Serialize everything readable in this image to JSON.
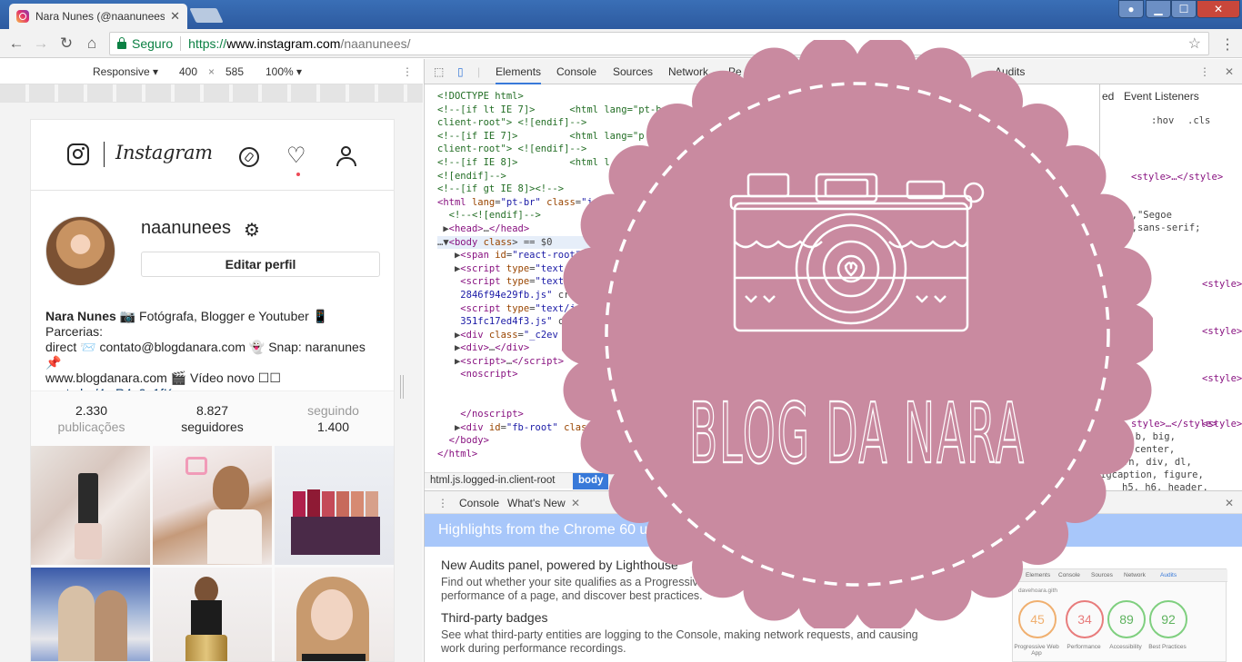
{
  "browser": {
    "tab_title": "Nara Nunes (@naanunees",
    "tab_close": "✕",
    "secure_label": "Seguro",
    "url_scheme": "https://",
    "url_host": "www.instagram.com",
    "url_path": "/naanunees/"
  },
  "device_toolbar": {
    "mode": "Responsive ▾",
    "width": "400",
    "times": "×",
    "height": "585",
    "zoom": "100% ▾"
  },
  "instagram": {
    "wordmark": "Instagram",
    "username": "naanunees",
    "edit_button": "Editar perfil",
    "bio_name": "Nara Nunes",
    "bio_line1": " 📷 Fotógrafa, Blogger e Youtuber 📱Parcerias:",
    "bio_line2": "direct 📨 contato@blogdanara.com 👻 Snap: naranunes 📌",
    "bio_line3": "www.blogdanara.com 🎬 Vídeo novo ☐☐",
    "bio_link": "youtu.be/4mR4u9o1fKw",
    "stats": [
      {
        "num": "2.330",
        "label": "publicações"
      },
      {
        "num": "8.827",
        "label": "seguidores"
      },
      {
        "num": "1.400",
        "label": "seguindo"
      }
    ]
  },
  "devtools": {
    "tabs": [
      "Elements",
      "Console",
      "Sources",
      "Network",
      "Pe",
      "Audits"
    ],
    "breadcrumb_path": "html.js.logged-in.client-root",
    "breadcrumb_active": "body",
    "styles": {
      "hov": ":hov",
      "cls": ".cls",
      "style1": "<style>…</style>",
      "font1": "nt,\"Segoe",
      "font2": "al,sans-serif;",
      "style2": "<style>",
      "style3": "<style>",
      "style4": "<style>",
      "style5": "<style>",
      "style6": "style>…</style>",
      "sel1": ", b, big,",
      "sel2": "tion, center,",
      "sel3": ", dfn, div, dl,",
      "sel4": "igcaption, figure,",
      "sel5": "h5, h6, header,"
    },
    "styles_tabs": {
      "ed": "ed",
      "listeners": "Event Listeners"
    },
    "drawer_tabs": [
      "Console",
      "What's New"
    ],
    "highlights_title": "Highlights from the Chrome 60 up",
    "whats_new": {
      "h1": "New Audits panel, powered by Lighthouse",
      "p1a": "Find out whether your site qualifies as a Progressive Web",
      "p1b": "performance of a page, and discover best practices.",
      "h2": "Third-party badges",
      "p2a": "See what third-party entities are logging to the Console, making network requests, and causing",
      "p2b": "work during performance recordings."
    },
    "audit_thumb": {
      "tabs": [
        "Elements",
        "Console",
        "Sources",
        "Network",
        "Audits"
      ],
      "url": "davehoara.gith",
      "scores": [
        {
          "value": "45",
          "label": "Progressive Web App",
          "color": "#f0b070"
        },
        {
          "value": "34",
          "label": "Performance",
          "color": "#e87c7c"
        },
        {
          "value": "89",
          "label": "Accessibility",
          "color": "#7fcf7f"
        },
        {
          "value": "92",
          "label": "Best Practices",
          "color": "#7fcf7f"
        }
      ]
    }
  },
  "badge": {
    "title": "BLOG DA NARA",
    "color": "#c98aa0"
  }
}
